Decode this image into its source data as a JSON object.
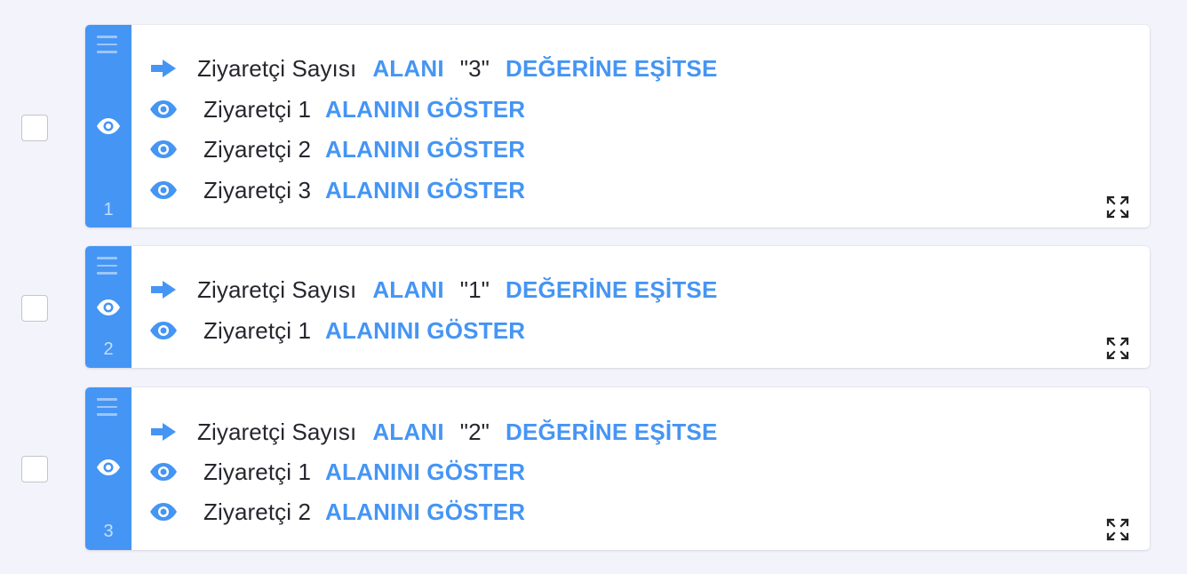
{
  "colors": {
    "accent": "#4595f4",
    "text": "#26262e",
    "background": "#f3f3fb",
    "card": "#ffffff"
  },
  "rules": [
    {
      "number": "1",
      "condition": {
        "field": "Ziyaretçi Sayısı",
        "field_keyword": "ALANI",
        "value": "\"3\"",
        "operator": "DEĞERİNE EŞİTSE"
      },
      "actions": [
        {
          "target": "Ziyaretçi 1",
          "action": "ALANINI GÖSTER"
        },
        {
          "target": "Ziyaretçi 2",
          "action": "ALANINI GÖSTER"
        },
        {
          "target": "Ziyaretçi 3",
          "action": "ALANINI GÖSTER"
        }
      ]
    },
    {
      "number": "2",
      "condition": {
        "field": "Ziyaretçi Sayısı",
        "field_keyword": "ALANI",
        "value": "\"1\"",
        "operator": "DEĞERİNE EŞİTSE"
      },
      "actions": [
        {
          "target": "Ziyaretçi 1",
          "action": "ALANINI GÖSTER"
        }
      ]
    },
    {
      "number": "3",
      "condition": {
        "field": "Ziyaretçi Sayısı",
        "field_keyword": "ALANI",
        "value": "\"2\"",
        "operator": "DEĞERİNE EŞİTSE"
      },
      "actions": [
        {
          "target": "Ziyaretçi 1",
          "action": "ALANINI GÖSTER"
        },
        {
          "target": "Ziyaretçi 2",
          "action": "ALANINI GÖSTER"
        }
      ]
    }
  ],
  "icons": {
    "drag": "drag-handle-icon",
    "side_eye": "eye-icon",
    "condition": "arrow-right-icon",
    "action": "eye-icon",
    "expand": "expand-icon"
  }
}
